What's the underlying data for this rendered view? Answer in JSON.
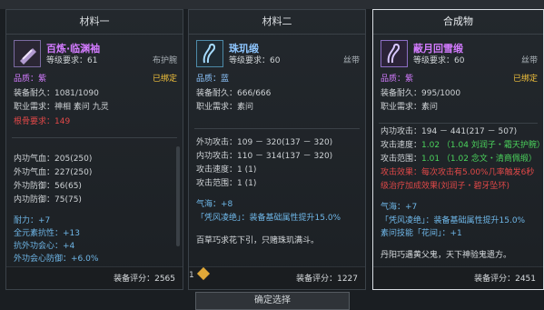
{
  "panels": [
    {
      "title": "材料一",
      "item_name": "百炼·临渊袖",
      "level_req": "等级要求：61",
      "type": "布护腕",
      "quality": "品质：紫",
      "bound": "已绑定",
      "durability": "装备耐久：1081/1090",
      "class_req": "职业需求：神相 素问 九灵",
      "root": "根骨要求：149",
      "stats": [
        {
          "label": "内功气血：",
          "value": "205(250)"
        },
        {
          "label": "外功气血：",
          "value": "227(250)"
        },
        {
          "label": "外功防御：",
          "value": "56(65)"
        },
        {
          "label": "内功防御：",
          "value": "75(75)"
        }
      ],
      "bonuses": [
        "耐力：+7",
        "全元素抗性：+13",
        "抗外功会心：+4",
        "外功会心防御：+6.0%"
      ],
      "score": "装备评分：2565"
    },
    {
      "title": "材料二",
      "item_name": "珠玑缎",
      "level_req": "等级要求：60",
      "type": "丝带",
      "quality": "品质：蓝",
      "durability": "装备耐久：666/666",
      "class_req": "职业需求：素问",
      "stats": [
        {
          "label": "外功攻击：",
          "value": "109 － 320(137 － 320)"
        },
        {
          "label": "内功攻击：",
          "value": "110 － 314(137 － 320)"
        },
        {
          "label": "攻击速度：",
          "value": "1 (1)"
        },
        {
          "label": "攻击范围：",
          "value": "1 (1)"
        }
      ],
      "bonus": "气海：+8",
      "set_effect": "「凭风凌绝」：装备基础属性提升15.0%",
      "flavor": "百草巧求花下引，只赌珠玑满斗。",
      "score": "装备评分：1227"
    },
    {
      "title": "合成物",
      "item_name": "蔽月回雪缎",
      "level_req": "等级要求：60",
      "type": "丝带",
      "quality": "品质：紫",
      "bound": "已绑定",
      "durability": "装备耐久：995/1000",
      "class_req": "职业需求：素问",
      "stats": [
        {
          "label": "内功攻击：",
          "value": "194 － 441(217 － 507)"
        },
        {
          "label": "攻击速度：",
          "value": "1.02 （1.04 刘润子・霜天护腕）"
        },
        {
          "label": "攻击范围：",
          "value": "1.01 （1.02 念文・清商佩缎）"
        }
      ],
      "effect_line1": "攻击效果：每次攻击有5.00%几率触发6秒",
      "effect_line2": "级治疗加成效果(刘润子・碧牙坠环)",
      "bonus": "气海：+7",
      "set_effect": "「凭风凌绝」：装备基础属性提升15.0%",
      "skill": "素问技能「花间」：+1",
      "flavor": "丹阳巧遇黄父鬼，天下神验鬼遗方。",
      "score": "装备评分：2451"
    }
  ],
  "bottom": {
    "count": "1",
    "button_label": "确定选择"
  }
}
